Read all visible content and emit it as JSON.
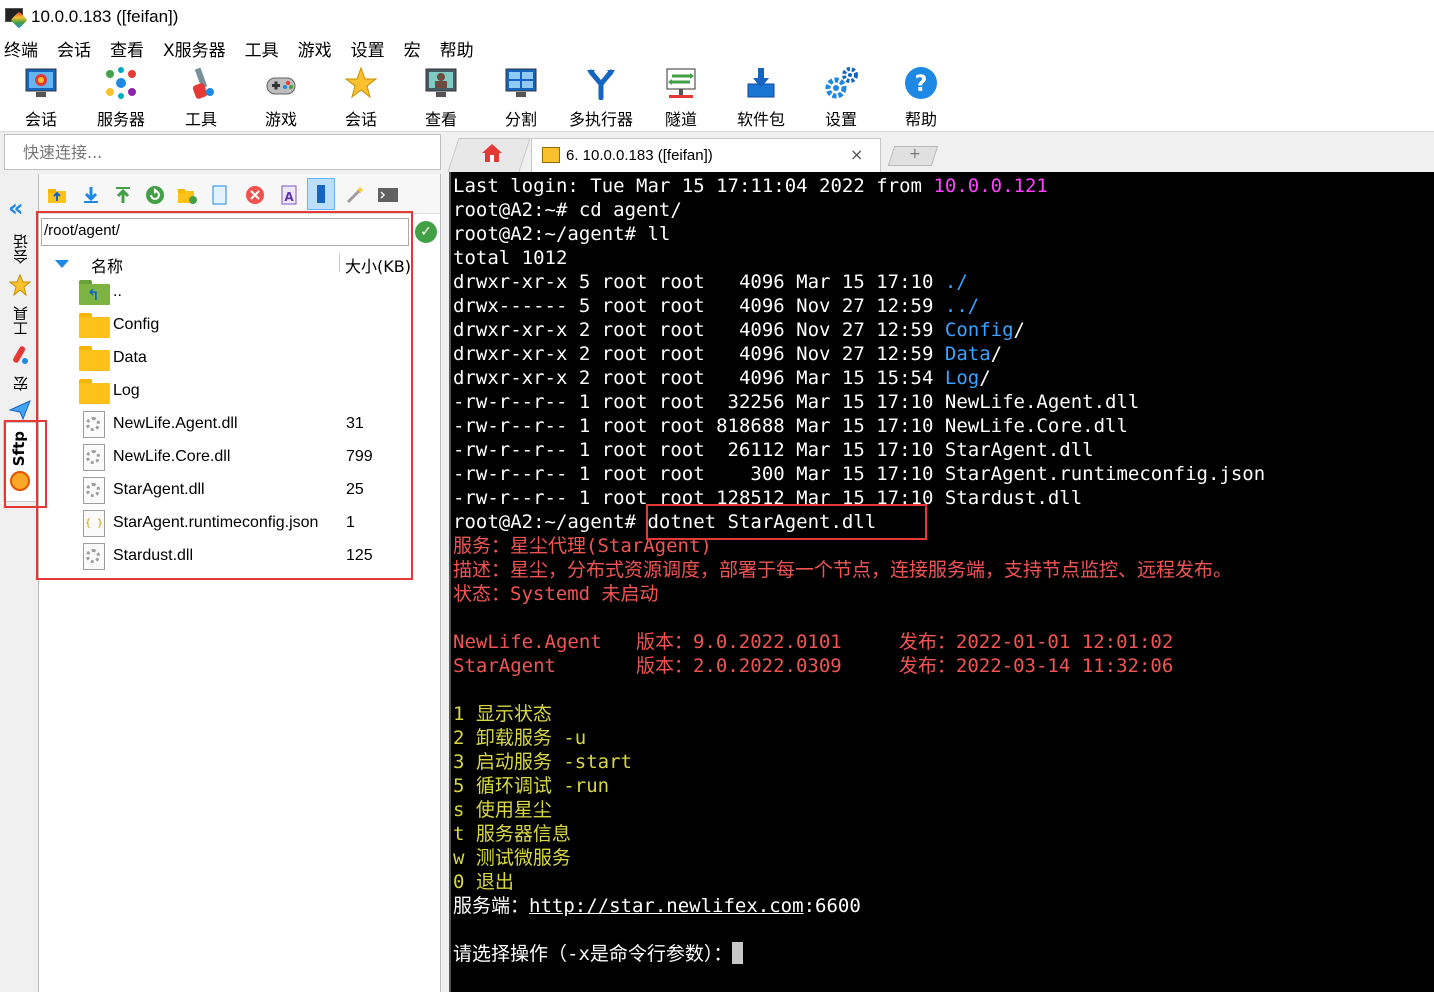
{
  "window": {
    "title": "10.0.0.183 ([feifan])"
  },
  "menu": [
    "终端",
    "会话",
    "查看",
    "X服务器",
    "工具",
    "游戏",
    "设置",
    "宏",
    "帮助"
  ],
  "toolbar": [
    "会话",
    "服务器",
    "工具",
    "游戏",
    "会话",
    "查看",
    "分割",
    "多执行器",
    "隧道",
    "软件包",
    "设置",
    "帮助"
  ],
  "quick_connect": {
    "placeholder": "快速连接..."
  },
  "side_tabs": {
    "sessions": "会话",
    "tools": "工具",
    "macros": "宏",
    "sftp": "Sftp"
  },
  "sftp": {
    "path": "/root/agent/",
    "col_name": "名称",
    "col_size": "大小(KB)",
    "files": [
      {
        "name": "..",
        "size": "",
        "type": "up"
      },
      {
        "name": "Config",
        "size": "",
        "type": "folder"
      },
      {
        "name": "Data",
        "size": "",
        "type": "folder"
      },
      {
        "name": "Log",
        "size": "",
        "type": "folder"
      },
      {
        "name": "NewLife.Agent.dll",
        "size": "31",
        "type": "dll"
      },
      {
        "name": "NewLife.Core.dll",
        "size": "799",
        "type": "dll"
      },
      {
        "name": "StarAgent.dll",
        "size": "25",
        "type": "dll"
      },
      {
        "name": "StarAgent.runtimeconfig.json",
        "size": "1",
        "type": "json"
      },
      {
        "name": "Stardust.dll",
        "size": "125",
        "type": "dll"
      }
    ]
  },
  "tabs": {
    "active_label": "6. 10.0.0.183 ([feifan])",
    "close": "×",
    "new": "+"
  },
  "terminal": {
    "lines": [
      {
        "segs": [
          [
            "Last login: Tue Mar 15 17:11:04 2022 from ",
            "c-white"
          ],
          [
            "10.0.0.121",
            "c-magenta"
          ]
        ]
      },
      {
        "segs": [
          [
            "root@A2:~# cd agent/",
            "c-white"
          ]
        ]
      },
      {
        "segs": [
          [
            "root@A2:~/agent# ll",
            "c-white"
          ]
        ]
      },
      {
        "segs": [
          [
            "total 1012",
            "c-white"
          ]
        ]
      },
      {
        "segs": [
          [
            "drwxr-xr-x 5 root root   4096 Mar 15 17:10 ",
            "c-white"
          ],
          [
            "./",
            "c-blue"
          ]
        ]
      },
      {
        "segs": [
          [
            "drwx------ 5 root root   4096 Nov 27 12:59 ",
            "c-white"
          ],
          [
            "../",
            "c-blue"
          ]
        ]
      },
      {
        "segs": [
          [
            "drwxr-xr-x 2 root root   4096 Nov 27 12:59 ",
            "c-white"
          ],
          [
            "Config",
            "c-blue"
          ],
          [
            "/",
            "c-white"
          ]
        ]
      },
      {
        "segs": [
          [
            "drwxr-xr-x 2 root root   4096 Nov 27 12:59 ",
            "c-white"
          ],
          [
            "Data",
            "c-blue"
          ],
          [
            "/",
            "c-white"
          ]
        ]
      },
      {
        "segs": [
          [
            "drwxr-xr-x 2 root root   4096 Mar 15 15:54 ",
            "c-white"
          ],
          [
            "Log",
            "c-blue"
          ],
          [
            "/",
            "c-white"
          ]
        ]
      },
      {
        "segs": [
          [
            "-rw-r--r-- 1 root root  32256 Mar 15 17:10 NewLife.Agent.dll",
            "c-white"
          ]
        ]
      },
      {
        "segs": [
          [
            "-rw-r--r-- 1 root root 818688 Mar 15 17:10 NewLife.Core.dll",
            "c-white"
          ]
        ]
      },
      {
        "segs": [
          [
            "-rw-r--r-- 1 root root  26112 Mar 15 17:10 StarAgent.dll",
            "c-white"
          ]
        ]
      },
      {
        "segs": [
          [
            "-rw-r--r-- 1 root root    300 Mar 15 17:10 StarAgent.runtimeconfig.json",
            "c-white"
          ]
        ]
      },
      {
        "segs": [
          [
            "-rw-r--r-- 1 root root 128512 Mar 15 17:10 Stardust.dll",
            "c-white"
          ]
        ]
      },
      {
        "segs": [
          [
            "root@A2:~/agent# dotnet StarAgent.dll",
            "c-white"
          ]
        ]
      },
      {
        "segs": [
          [
            "服务：星尘代理(StarAgent)",
            "c-red"
          ]
        ]
      },
      {
        "segs": [
          [
            "描述：星尘，分布式资源调度，部署于每一个节点，连接服务端，支持节点监控、远程发布。",
            "c-red"
          ]
        ]
      },
      {
        "segs": [
          [
            "状态：Systemd 未启动",
            "c-red"
          ]
        ]
      },
      {
        "segs": []
      },
      {
        "segs": [
          [
            "NewLife.Agent   版本：9.0.2022.0101     发布：2022-01-01 12:01:02",
            "c-red"
          ]
        ]
      },
      {
        "segs": [
          [
            "StarAgent       版本：2.0.2022.0309     发布：2022-03-14 11:32:06",
            "c-red"
          ]
        ]
      },
      {
        "segs": []
      },
      {
        "segs": [
          [
            "1 显示状态",
            "c-yellow"
          ]
        ]
      },
      {
        "segs": [
          [
            "2 卸载服务 -u",
            "c-yellow"
          ]
        ]
      },
      {
        "segs": [
          [
            "3 启动服务 -start",
            "c-yellow"
          ]
        ]
      },
      {
        "segs": [
          [
            "5 循环调试 -run",
            "c-yellow"
          ]
        ]
      },
      {
        "segs": [
          [
            "s 使用星尘",
            "c-yellow"
          ]
        ]
      },
      {
        "segs": [
          [
            "t 服务器信息",
            "c-yellow"
          ]
        ]
      },
      {
        "segs": [
          [
            "w 测试微服务",
            "c-yellow"
          ]
        ]
      },
      {
        "segs": [
          [
            "0 退出",
            "c-yellow"
          ]
        ]
      },
      {
        "segs": [
          [
            "服务端：",
            "c-white"
          ],
          [
            "http://star.newlifex.com",
            "c-white underline"
          ],
          [
            ":6600",
            "c-white"
          ]
        ]
      },
      {
        "segs": []
      },
      {
        "segs": [
          [
            "请选择操作（-x是命令行参数）：",
            "c-white"
          ]
        ],
        "cursor": true
      }
    ]
  },
  "colors": {
    "highlight": "#e53935",
    "terminal_bg": "#000000",
    "red_text": "#f25454",
    "yellow_text": "#d7d744",
    "dir_blue": "#3ba3ff",
    "ip_magenta": "#ff40ff"
  }
}
